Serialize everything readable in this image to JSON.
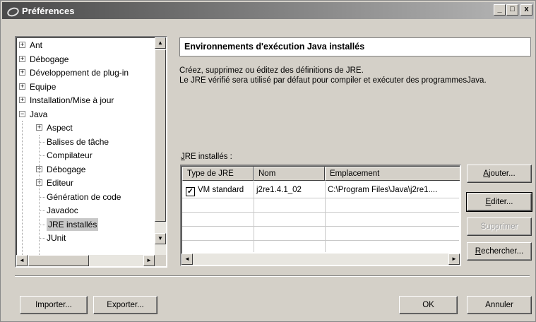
{
  "window": {
    "title": "Préférences",
    "controls": [
      "_",
      "□",
      "x"
    ]
  },
  "tree": {
    "items": [
      {
        "label": "Ant",
        "level": 0,
        "expander": "+"
      },
      {
        "label": "Débogage",
        "level": 0,
        "expander": "+"
      },
      {
        "label": "Développement de plug-in",
        "level": 0,
        "expander": "+"
      },
      {
        "label": "Equipe",
        "level": 0,
        "expander": "+"
      },
      {
        "label": "Installation/Mise à jour",
        "level": 0,
        "expander": "+"
      },
      {
        "label": "Java",
        "level": 0,
        "expander": "−"
      },
      {
        "label": "Aspect",
        "level": 1,
        "expander": "+"
      },
      {
        "label": "Balises de tâche",
        "level": 1,
        "expander": ""
      },
      {
        "label": "Compilateur",
        "level": 1,
        "expander": ""
      },
      {
        "label": "Débogage",
        "level": 1,
        "expander": "+"
      },
      {
        "label": "Editeur",
        "level": 1,
        "expander": "+"
      },
      {
        "label": "Génération de code",
        "level": 1,
        "expander": ""
      },
      {
        "label": "Javadoc",
        "level": 1,
        "expander": ""
      },
      {
        "label": "JRE installés",
        "level": 1,
        "expander": "",
        "selected": true
      },
      {
        "label": "JUnit",
        "level": 1,
        "expander": ""
      }
    ]
  },
  "panel": {
    "title": "Environnements d'exécution Java installés",
    "description_line1": "Créez, supprimez ou éditez des définitions de JRE.",
    "description_line2": "Le JRE vérifié sera utilisé par défaut pour compiler et exécuter des programmesJava.",
    "jre_label_mnemonic": "J",
    "jre_label_rest": "RE installés :"
  },
  "table": {
    "columns": [
      "Type de JRE",
      "Nom",
      "Emplacement"
    ],
    "rows": [
      {
        "checked": true,
        "type": "VM standard",
        "name": "j2re1.4.1_02",
        "location": "C:\\Program Files\\Java\\j2re1...."
      }
    ]
  },
  "buttons": {
    "add_mn": "A",
    "add_rest": "jouter...",
    "edit_mn": "E",
    "edit_rest": "diter...",
    "remove": "Supprimer",
    "search_mn": "R",
    "search_rest": "echercher...",
    "import": "Importer...",
    "export": "Exporter...",
    "ok": "OK",
    "cancel": "Annuler"
  },
  "scroll_glyphs": {
    "up": "▲",
    "down": "▼",
    "left": "◄",
    "right": "►"
  }
}
